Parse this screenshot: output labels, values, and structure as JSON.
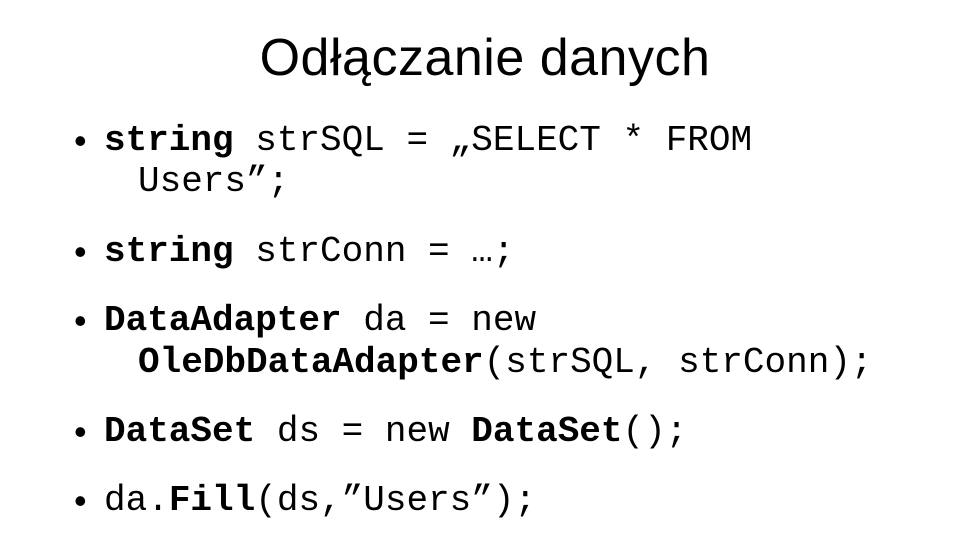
{
  "title": "Odłączanie danych",
  "code": {
    "line1_pre": "string",
    "line1_mid": " strSQL = „SELECT * FROM",
    "line1_cont": "Users”;",
    "line2_pre": "string",
    "line2_rest": " strConn = …;",
    "line3_pre": "DataAdapter",
    "line3_mid": " da = new",
    "line3_cont_b": "OleDbDataAdapter",
    "line3_cont_rest": "(strSQL, strConn);",
    "line4_pre": "DataSet",
    "line4_mid": " ds = new ",
    "line4_b2": "DataSet",
    "line4_rest": "();",
    "line5_pre": "da.",
    "line5_b": "Fill",
    "line5_rest": "(ds,”Users”);"
  }
}
